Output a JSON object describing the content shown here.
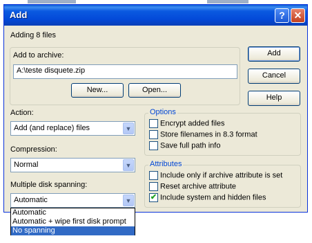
{
  "dialog": {
    "title": "Add",
    "help_button": "?",
    "close_button": "✕",
    "status": "Adding 8 files"
  },
  "archive": {
    "group_label": "Add to archive:",
    "path": "A:\\teste disquete.zip",
    "new_button": "New...",
    "open_button": "Open..."
  },
  "buttons": {
    "add": "Add",
    "cancel": "Cancel",
    "help": "Help"
  },
  "action": {
    "label": "Action:",
    "value": "Add (and replace) files"
  },
  "compression": {
    "label": "Compression:",
    "value": "Normal"
  },
  "spanning": {
    "label": "Multiple disk spanning:",
    "value": "Automatic",
    "options": [
      "Automatic",
      "Automatic + wipe first disk prompt",
      "No spanning"
    ],
    "highlighted_option": "No spanning"
  },
  "options": {
    "group_label": "Options",
    "items": [
      {
        "label": "Encrypt added files",
        "checked": false
      },
      {
        "label": "Store filenames in 8.3 format",
        "checked": false
      },
      {
        "label": "Save full path info",
        "checked": false
      }
    ]
  },
  "attributes": {
    "group_label": "Attributes",
    "items": [
      {
        "label": "Include only if archive attribute is set",
        "checked": false
      },
      {
        "label": "Reset archive attribute",
        "checked": false
      },
      {
        "label": "Include system and hidden files",
        "checked": true
      }
    ]
  },
  "colors": {
    "titlebar": "#0349d8",
    "dialog_bg": "#ece9d8",
    "group_title": "#0046d5",
    "selection": "#316ac5"
  }
}
